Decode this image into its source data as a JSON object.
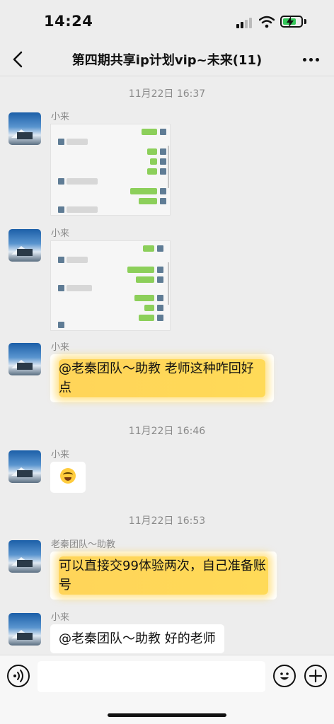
{
  "status": {
    "time": "14:24",
    "battery_color": "#34c759"
  },
  "nav": {
    "title": "第四期共享ip计划vip~未来(11)",
    "back_icon": "chevron-left-icon",
    "more_icon": "more-dots-icon"
  },
  "chat": {
    "timestamps": [
      "11月22日 16:37",
      "11月22日 16:46",
      "11月22日 16:53"
    ],
    "messages": [
      {
        "sender": "小来",
        "type": "image"
      },
      {
        "sender": "小来",
        "type": "image"
      },
      {
        "sender": "小来",
        "type": "text",
        "text": "@老秦团队～助教 老师这种咋回好点",
        "highlight_color": "#ffd246"
      },
      {
        "sender": "小来",
        "type": "emoji",
        "emoji": "crying-laughing-emoji"
      },
      {
        "sender": "老秦团队～助教",
        "type": "text",
        "text": "可以直接交99体验两次，自己准备账号",
        "highlight_color": "#ffd246"
      },
      {
        "sender": "小来",
        "type": "text",
        "text": "@老秦团队～助教 好的老师"
      }
    ]
  },
  "input_bar": {
    "voice_icon": "voice-icon",
    "emoji_icon": "smile-icon",
    "plus_icon": "plus-icon",
    "placeholder": ""
  }
}
